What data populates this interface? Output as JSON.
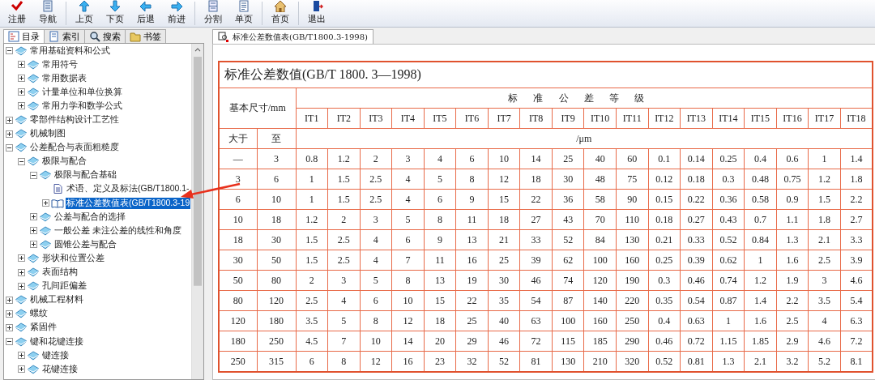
{
  "toolbar": {
    "groups": [
      [
        {
          "label": "注册",
          "kind": "check"
        },
        {
          "label": "导航",
          "kind": "document"
        }
      ],
      [
        {
          "label": "上页",
          "kind": "up"
        },
        {
          "label": "下页",
          "kind": "down"
        },
        {
          "label": "后退",
          "kind": "left"
        },
        {
          "label": "前进",
          "kind": "right"
        }
      ],
      [
        {
          "label": "分割",
          "kind": "split"
        },
        {
          "label": "单页",
          "kind": "page"
        }
      ],
      [
        {
          "label": "首页",
          "kind": "home"
        }
      ],
      [
        {
          "label": "退出",
          "kind": "exit"
        }
      ]
    ]
  },
  "sidebar": {
    "tabs": [
      {
        "label": "目录",
        "kind": "contents",
        "selected": true
      },
      {
        "label": "索引",
        "kind": "index",
        "selected": false
      },
      {
        "label": "搜索",
        "kind": "search",
        "selected": false
      },
      {
        "label": "书签",
        "kind": "bookmark",
        "selected": false
      }
    ],
    "tree": [
      {
        "label": "常用基础资料和公式",
        "kind": "book",
        "expanded": true,
        "selected": false,
        "children": [
          {
            "label": "常用符号",
            "kind": "book",
            "expanded": false,
            "selected": false
          },
          {
            "label": "常用数据表",
            "kind": "book",
            "expanded": false,
            "selected": false
          },
          {
            "label": "计量单位和单位换算",
            "kind": "book",
            "expanded": false,
            "selected": false
          },
          {
            "label": "常用力学和数学公式",
            "kind": "book",
            "expanded": false,
            "selected": false
          }
        ]
      },
      {
        "label": "零部件结构设计工艺性",
        "kind": "book",
        "expanded": false,
        "selected": false
      },
      {
        "label": "机械制图",
        "kind": "book",
        "expanded": false,
        "selected": false
      },
      {
        "label": "公差配合与表面粗糙度",
        "kind": "book",
        "expanded": true,
        "selected": false,
        "children": [
          {
            "label": "极限与配合",
            "kind": "book",
            "expanded": true,
            "selected": false,
            "children": [
              {
                "label": "极限与配合基础",
                "kind": "book",
                "expanded": true,
                "selected": false,
                "children": [
                  {
                    "label": "术语、定义及标法(GB/T1800.1-",
                    "kind": "page",
                    "selected": false
                  },
                  {
                    "label": "标准公差数值表(GB/T1800.3-19",
                    "kind": "open-book",
                    "expanded": false,
                    "selected": true
                  }
                ]
              },
              {
                "label": "公差与配合的选择",
                "kind": "book",
                "expanded": false,
                "selected": false
              },
              {
                "label": "一般公差 未注公差的线性和角度",
                "kind": "book",
                "expanded": false,
                "selected": false
              },
              {
                "label": "圆锥公差与配合",
                "kind": "book",
                "expanded": false,
                "selected": false
              }
            ]
          },
          {
            "label": "形状和位置公差",
            "kind": "book",
            "expanded": false,
            "selected": false
          },
          {
            "label": "表面结构",
            "kind": "book",
            "expanded": false,
            "selected": false
          },
          {
            "label": "孔间距偏差",
            "kind": "book",
            "expanded": false,
            "selected": false
          }
        ]
      },
      {
        "label": "机械工程材料",
        "kind": "book",
        "expanded": false,
        "selected": false
      },
      {
        "label": "螺纹",
        "kind": "book",
        "expanded": false,
        "selected": false
      },
      {
        "label": "紧固件",
        "kind": "book",
        "expanded": false,
        "selected": false
      },
      {
        "label": "键和花键连接",
        "kind": "book",
        "expanded": true,
        "selected": false,
        "children": [
          {
            "label": "键连接",
            "kind": "book",
            "expanded": false,
            "selected": false
          },
          {
            "label": "花键连接",
            "kind": "book",
            "expanded": false,
            "selected": false
          }
        ]
      }
    ]
  },
  "document_tabs": [
    {
      "label": "标准公差数值表(GB/T1800.3-1998)",
      "selected": true
    }
  ],
  "table": {
    "title": "标准公差数值(GB/T 1800. 3—1998)",
    "size_label": "基本尺寸/mm",
    "grade_label": "标准公差等级",
    "from_label": "大于",
    "to_label": "至",
    "unit": "/μm",
    "columns": [
      "IT1",
      "IT2",
      "IT3",
      "IT4",
      "IT5",
      "IT6",
      "IT7",
      "IT8",
      "IT9",
      "IT10",
      "IT11",
      "IT12",
      "IT13",
      "IT14",
      "IT15",
      "IT16",
      "IT17",
      "IT18"
    ],
    "rows": [
      {
        "from": "—",
        "to": "3",
        "values": [
          "0.8",
          "1.2",
          "2",
          "3",
          "4",
          "6",
          "10",
          "14",
          "25",
          "40",
          "60",
          "0.1",
          "0.14",
          "0.25",
          "0.4",
          "0.6",
          "1",
          "1.4"
        ]
      },
      {
        "from": "3",
        "to": "6",
        "values": [
          "1",
          "1.5",
          "2.5",
          "4",
          "5",
          "8",
          "12",
          "18",
          "30",
          "48",
          "75",
          "0.12",
          "0.18",
          "0.3",
          "0.48",
          "0.75",
          "1.2",
          "1.8"
        ]
      },
      {
        "from": "6",
        "to": "10",
        "values": [
          "1",
          "1.5",
          "2.5",
          "4",
          "6",
          "9",
          "15",
          "22",
          "36",
          "58",
          "90",
          "0.15",
          "0.22",
          "0.36",
          "0.58",
          "0.9",
          "1.5",
          "2.2"
        ]
      },
      {
        "from": "10",
        "to": "18",
        "values": [
          "1.2",
          "2",
          "3",
          "5",
          "8",
          "11",
          "18",
          "27",
          "43",
          "70",
          "110",
          "0.18",
          "0.27",
          "0.43",
          "0.7",
          "1.1",
          "1.8",
          "2.7"
        ]
      },
      {
        "from": "18",
        "to": "30",
        "values": [
          "1.5",
          "2.5",
          "4",
          "6",
          "9",
          "13",
          "21",
          "33",
          "52",
          "84",
          "130",
          "0.21",
          "0.33",
          "0.52",
          "0.84",
          "1.3",
          "2.1",
          "3.3"
        ]
      },
      {
        "from": "30",
        "to": "50",
        "values": [
          "1.5",
          "2.5",
          "4",
          "7",
          "11",
          "16",
          "25",
          "39",
          "62",
          "100",
          "160",
          "0.25",
          "0.39",
          "0.62",
          "1",
          "1.6",
          "2.5",
          "3.9"
        ]
      },
      {
        "from": "50",
        "to": "80",
        "values": [
          "2",
          "3",
          "5",
          "8",
          "13",
          "19",
          "30",
          "46",
          "74",
          "120",
          "190",
          "0.3",
          "0.46",
          "0.74",
          "1.2",
          "1.9",
          "3",
          "4.6"
        ]
      },
      {
        "from": "80",
        "to": "120",
        "values": [
          "2.5",
          "4",
          "6",
          "10",
          "15",
          "22",
          "35",
          "54",
          "87",
          "140",
          "220",
          "0.35",
          "0.54",
          "0.87",
          "1.4",
          "2.2",
          "3.5",
          "5.4"
        ]
      },
      {
        "from": "120",
        "to": "180",
        "values": [
          "3.5",
          "5",
          "8",
          "12",
          "18",
          "25",
          "40",
          "63",
          "100",
          "160",
          "250",
          "0.4",
          "0.63",
          "1",
          "1.6",
          "2.5",
          "4",
          "6.3"
        ]
      },
      {
        "from": "180",
        "to": "250",
        "values": [
          "4.5",
          "7",
          "10",
          "14",
          "20",
          "29",
          "46",
          "72",
          "115",
          "185",
          "290",
          "0.46",
          "0.72",
          "1.15",
          "1.85",
          "2.9",
          "4.6",
          "7.2"
        ]
      },
      {
        "from": "250",
        "to": "315",
        "values": [
          "6",
          "8",
          "12",
          "16",
          "23",
          "32",
          "52",
          "81",
          "130",
          "210",
          "320",
          "0.52",
          "0.81",
          "1.3",
          "2.1",
          "3.2",
          "5.2",
          "8.1"
        ]
      }
    ]
  }
}
